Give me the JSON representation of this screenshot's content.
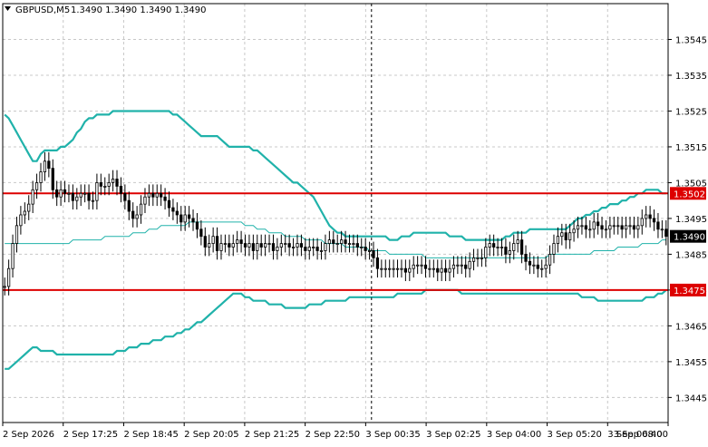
{
  "header": {
    "symbol_timeframe": "GBPUSD,M5",
    "ohlc": "1.3490 1.3490 1.3490 1.3490",
    "collapse_icon": "triangle-down-icon"
  },
  "colors": {
    "background": "#ffffff",
    "grid": "#c8c8c8",
    "candle": "#000000",
    "bollinger": "#20b2aa",
    "level_line": "#dd0000",
    "price_tag_bg": "#000000",
    "price_tag_text": "#ffffff",
    "level_tag_bg": "#dd0000",
    "level_tag_text": "#ffffff"
  },
  "chart_data": {
    "type": "candlestick",
    "symbol": "GBPUSD",
    "timeframe": "M5",
    "grid": true,
    "ylim": [
      1.3438,
      1.3555
    ],
    "y_ticks": [
      "1.3545",
      "1.3535",
      "1.3525",
      "1.3515",
      "1.3505",
      "1.3495",
      "1.3485",
      "1.3475",
      "1.3465",
      "1.3455",
      "1.3445"
    ],
    "x_ticks": [
      "2 Sep 2026",
      "2 Sep 17:25",
      "2 Sep 18:45",
      "2 Sep 20:05",
      "2 Sep 21:25",
      "2 Sep 22:50",
      "3 Sep 00:35",
      "3 Sep 02:25",
      "3 Sep 04:00",
      "3 Sep 05:20",
      "3 Sep 06:40",
      "3 Sep 08:00"
    ],
    "levels": [
      {
        "value": 1.3502,
        "label": "1.3502"
      },
      {
        "value": 1.3475,
        "label": "1.3475"
      }
    ],
    "current_price": {
      "value": 1.349,
      "label": "1.3490"
    },
    "period_separator_index": 92,
    "closes": [
      1.3476,
      1.3481,
      1.3488,
      1.3493,
      1.3496,
      1.3497,
      1.3499,
      1.3503,
      1.3505,
      1.3508,
      1.3511,
      1.3509,
      1.3503,
      1.3501,
      1.3503,
      1.3502,
      1.3502,
      1.35,
      1.3501,
      1.3502,
      1.3502,
      1.35,
      1.35,
      1.3505,
      1.3504,
      1.3504,
      1.3505,
      1.3506,
      1.3504,
      1.3502,
      1.35,
      1.3497,
      1.3495,
      1.3496,
      1.3499,
      1.3501,
      1.3502,
      1.3501,
      1.3502,
      1.3501,
      1.35,
      1.3498,
      1.3497,
      1.3496,
      1.3494,
      1.3496,
      1.3495,
      1.3494,
      1.3492,
      1.349,
      1.3487,
      1.3488,
      1.349,
      1.3486,
      1.3488,
      1.3488,
      1.3487,
      1.3488,
      1.3489,
      1.3488,
      1.3487,
      1.3488,
      1.3486,
      1.3488,
      1.3487,
      1.3488,
      1.3488,
      1.3486,
      1.3487,
      1.3488,
      1.3488,
      1.3487,
      1.3487,
      1.3488,
      1.3487,
      1.3486,
      1.3487,
      1.3487,
      1.3486,
      1.3486,
      1.3488,
      1.3489,
      1.3488,
      1.3488,
      1.3489,
      1.3488,
      1.3488,
      1.3488,
      1.3487,
      1.3487,
      1.3486,
      1.3486,
      1.3484,
      1.3481,
      1.3481,
      1.3481,
      1.3481,
      1.3481,
      1.3481,
      1.3481,
      1.348,
      1.3481,
      1.3482,
      1.3482,
      1.3482,
      1.3481,
      1.3481,
      1.3481,
      1.348,
      1.3481,
      1.348,
      1.3481,
      1.3482,
      1.3482,
      1.3482,
      1.3481,
      1.3483,
      1.3484,
      1.3484,
      1.3484,
      1.3487,
      1.3488,
      1.3487,
      1.3487,
      1.3487,
      1.3485,
      1.3486,
      1.3488,
      1.3489,
      1.3485,
      1.3483,
      1.3482,
      1.3482,
      1.3481,
      1.3481,
      1.3482,
      1.3485,
      1.3488,
      1.349,
      1.3491,
      1.3489,
      1.3491,
      1.3492,
      1.3493,
      1.3493,
      1.3492,
      1.3492,
      1.3494,
      1.3493,
      1.3492,
      1.3492,
      1.3493,
      1.3493,
      1.3493,
      1.3492,
      1.3493,
      1.3493,
      1.3492,
      1.3493,
      1.3495,
      1.3496,
      1.3495,
      1.3494,
      1.3492,
      1.3492,
      1.349
    ],
    "bb_upper": [
      1.3524,
      1.3523,
      1.3521,
      1.3519,
      1.3517,
      1.3515,
      1.3513,
      1.3511,
      1.3511,
      1.3513,
      1.3514,
      1.3514,
      1.3514,
      1.3514,
      1.3515,
      1.3515,
      1.3516,
      1.3517,
      1.3519,
      1.352,
      1.3522,
      1.3523,
      1.3523,
      1.3524,
      1.3524,
      1.3524,
      1.3524,
      1.3525,
      1.3525,
      1.3525,
      1.3525,
      1.3525,
      1.3525,
      1.3525,
      1.3525,
      1.3525,
      1.3525,
      1.3525,
      1.3525,
      1.3525,
      1.3525,
      1.3525,
      1.3524,
      1.3524,
      1.3523,
      1.3522,
      1.3521,
      1.352,
      1.3519,
      1.3518,
      1.3518,
      1.3518,
      1.3518,
      1.3518,
      1.3517,
      1.3516,
      1.3515,
      1.3515,
      1.3515,
      1.3515,
      1.3515,
      1.3515,
      1.3514,
      1.3514,
      1.3513,
      1.3512,
      1.3511,
      1.351,
      1.3509,
      1.3508,
      1.3507,
      1.3506,
      1.3505,
      1.3505,
      1.3504,
      1.3503,
      1.3502,
      1.3501,
      1.3499,
      1.3497,
      1.3495,
      1.3493,
      1.3492,
      1.3491,
      1.3491,
      1.349,
      1.349,
      1.349,
      1.349,
      1.349,
      1.349,
      1.349,
      1.349,
      1.349,
      1.349,
      1.349,
      1.3489,
      1.3489,
      1.3489,
      1.349,
      1.349,
      1.349,
      1.3491,
      1.3491,
      1.3491,
      1.3491,
      1.3491,
      1.3491,
      1.3491,
      1.3491,
      1.3491,
      1.349,
      1.349,
      1.349,
      1.349,
      1.3489,
      1.3489,
      1.3489,
      1.3489,
      1.3489,
      1.3489,
      1.3489,
      1.3489,
      1.3489,
      1.3489,
      1.349,
      1.349,
      1.3491,
      1.3491,
      1.3491,
      1.3491,
      1.3492,
      1.3492,
      1.3492,
      1.3492,
      1.3492,
      1.3492,
      1.3492,
      1.3492,
      1.3492,
      1.3492,
      1.3493,
      1.3494,
      1.3495,
      1.3495,
      1.3496,
      1.3496,
      1.3497,
      1.3497,
      1.3498,
      1.3498,
      1.3499,
      1.3499,
      1.3499,
      1.35,
      1.35,
      1.3501,
      1.3501,
      1.3502,
      1.3502,
      1.3503,
      1.3503,
      1.3503,
      1.3503,
      1.3502,
      1.3502
    ],
    "bb_middle": [
      1.3488,
      1.3488,
      1.3488,
      1.3488,
      1.3488,
      1.3488,
      1.3488,
      1.3488,
      1.3488,
      1.3488,
      1.3488,
      1.3488,
      1.3488,
      1.3488,
      1.3488,
      1.3488,
      1.3488,
      1.3489,
      1.3489,
      1.3489,
      1.3489,
      1.3489,
      1.3489,
      1.3489,
      1.3489,
      1.349,
      1.349,
      1.349,
      1.349,
      1.349,
      1.349,
      1.349,
      1.3491,
      1.3491,
      1.3491,
      1.3491,
      1.3492,
      1.3492,
      1.3492,
      1.3493,
      1.3493,
      1.3493,
      1.3493,
      1.3493,
      1.3493,
      1.3493,
      1.3494,
      1.3494,
      1.3494,
      1.3494,
      1.3494,
      1.3494,
      1.3494,
      1.3494,
      1.3494,
      1.3494,
      1.3494,
      1.3494,
      1.3494,
      1.3494,
      1.3493,
      1.3493,
      1.3493,
      1.3492,
      1.3492,
      1.3492,
      1.3491,
      1.3491,
      1.3491,
      1.3491,
      1.349,
      1.349,
      1.349,
      1.349,
      1.349,
      1.3489,
      1.3489,
      1.3489,
      1.3489,
      1.3489,
      1.3488,
      1.3488,
      1.3488,
      1.3488,
      1.3488,
      1.3487,
      1.3487,
      1.3487,
      1.3487,
      1.3487,
      1.3487,
      1.3486,
      1.3486,
      1.3486,
      1.3486,
      1.3486,
      1.3485,
      1.3485,
      1.3485,
      1.3485,
      1.3485,
      1.3485,
      1.3485,
      1.3485,
      1.3485,
      1.3484,
      1.3484,
      1.3484,
      1.3484,
      1.3484,
      1.3484,
      1.3484,
      1.3484,
      1.3484,
      1.3484,
      1.3484,
      1.3484,
      1.3484,
      1.3484,
      1.3484,
      1.3484,
      1.3484,
      1.3484,
      1.3484,
      1.3484,
      1.3484,
      1.3484,
      1.3484,
      1.3484,
      1.3484,
      1.3484,
      1.3484,
      1.3484,
      1.3484,
      1.3484,
      1.3484,
      1.3485,
      1.3485,
      1.3485,
      1.3485,
      1.3485,
      1.3485,
      1.3485,
      1.3485,
      1.3485,
      1.3485,
      1.3485,
      1.3486,
      1.3486,
      1.3486,
      1.3486,
      1.3486,
      1.3486,
      1.3487,
      1.3487,
      1.3487,
      1.3487,
      1.3487,
      1.3487,
      1.3488,
      1.3488,
      1.3488,
      1.3488,
      1.3488,
      1.3489,
      1.3489
    ],
    "bb_lower": [
      1.3453,
      1.3453,
      1.3454,
      1.3455,
      1.3456,
      1.3457,
      1.3458,
      1.3459,
      1.3459,
      1.3458,
      1.3458,
      1.3458,
      1.3458,
      1.3457,
      1.3457,
      1.3457,
      1.3457,
      1.3457,
      1.3457,
      1.3457,
      1.3457,
      1.3457,
      1.3457,
      1.3457,
      1.3457,
      1.3457,
      1.3457,
      1.3457,
      1.3458,
      1.3458,
      1.3458,
      1.3459,
      1.3459,
      1.3459,
      1.346,
      1.346,
      1.346,
      1.3461,
      1.3461,
      1.3461,
      1.3462,
      1.3462,
      1.3462,
      1.3463,
      1.3463,
      1.3464,
      1.3464,
      1.3465,
      1.3466,
      1.3466,
      1.3467,
      1.3468,
      1.3469,
      1.347,
      1.3471,
      1.3472,
      1.3473,
      1.3474,
      1.3474,
      1.3474,
      1.3473,
      1.3473,
      1.3472,
      1.3472,
      1.3472,
      1.3472,
      1.3471,
      1.3471,
      1.3471,
      1.3471,
      1.347,
      1.347,
      1.347,
      1.347,
      1.347,
      1.347,
      1.3471,
      1.3471,
      1.3471,
      1.3471,
      1.3472,
      1.3472,
      1.3472,
      1.3472,
      1.3472,
      1.3472,
      1.3473,
      1.3473,
      1.3473,
      1.3473,
      1.3473,
      1.3473,
      1.3473,
      1.3473,
      1.3473,
      1.3473,
      1.3473,
      1.3473,
      1.3474,
      1.3474,
      1.3474,
      1.3474,
      1.3474,
      1.3474,
      1.3474,
      1.3475,
      1.3475,
      1.3475,
      1.3475,
      1.3475,
      1.3475,
      1.3475,
      1.3475,
      1.3475,
      1.3474,
      1.3474,
      1.3474,
      1.3474,
      1.3474,
      1.3474,
      1.3474,
      1.3474,
      1.3474,
      1.3474,
      1.3474,
      1.3474,
      1.3474,
      1.3474,
      1.3474,
      1.3474,
      1.3474,
      1.3474,
      1.3474,
      1.3474,
      1.3474,
      1.3474,
      1.3474,
      1.3474,
      1.3474,
      1.3474,
      1.3474,
      1.3474,
      1.3474,
      1.3474,
      1.3473,
      1.3473,
      1.3473,
      1.3473,
      1.3472,
      1.3472,
      1.3472,
      1.3472,
      1.3472,
      1.3472,
      1.3472,
      1.3472,
      1.3472,
      1.3472,
      1.3472,
      1.3472,
      1.3473,
      1.3473,
      1.3473,
      1.3474,
      1.3474,
      1.3475
    ]
  }
}
